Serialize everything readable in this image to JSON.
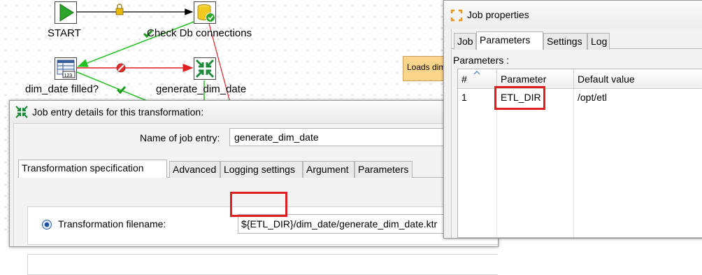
{
  "canvas": {
    "nodes": {
      "start": "START",
      "check_db": "Check Db connections",
      "dim_date_filled": "dim_date filled?",
      "generate_dim_date": "generate_dim_date"
    },
    "note_text": "Loads dim",
    "hop_colors": {
      "unconditional": "#000000",
      "success": "#22c022",
      "failure": "#e02020"
    }
  },
  "entry_dialog": {
    "title": "Job entry details for this transformation:",
    "name_label": "Name of job entry:",
    "name_value": "generate_dim_date",
    "tabs": [
      "Transformation specification",
      "Advanced",
      "Logging settings",
      "Argument",
      "Parameters"
    ],
    "active_tab": "Transformation specification",
    "radio_label": "Transformation filename:",
    "filename_var": "${ETL_DIR}",
    "filename_rest": "/dim_date/generate_dim_date.ktr"
  },
  "job_dialog": {
    "title": "Job properties",
    "tabs": [
      "Job",
      "Parameters",
      "Settings",
      "Log"
    ],
    "active_tab": "Parameters",
    "params_caption": "Parameters :",
    "columns": [
      "#",
      "Parameter",
      "Default value"
    ],
    "rows": [
      {
        "num": "1",
        "parameter": "ETL_DIR",
        "default": "/opt/etl"
      }
    ]
  },
  "highlight_color": "#e02020"
}
